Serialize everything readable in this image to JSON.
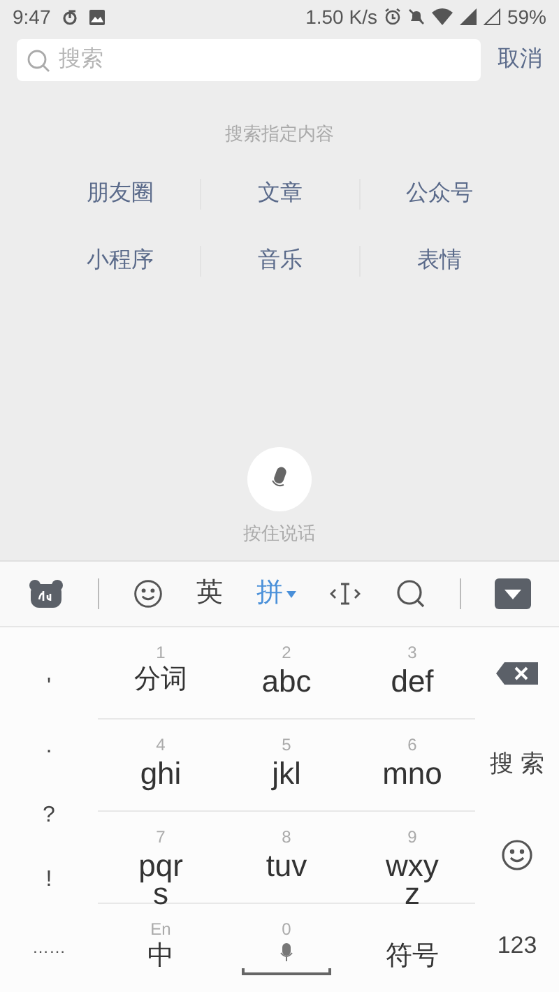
{
  "status_bar": {
    "time": "9:47",
    "speed": "1.50 K/s",
    "battery": "59%"
  },
  "search": {
    "placeholder": "搜索",
    "cancel": "取消"
  },
  "section_title": "搜索指定内容",
  "categories": [
    "朋友圈",
    "文章",
    "公众号",
    "小程序",
    "音乐",
    "表情"
  ],
  "voice": {
    "label": "按住说话"
  },
  "toolbar": [
    {
      "kind": "logo"
    },
    {
      "kind": "divider"
    },
    {
      "kind": "emoji"
    },
    {
      "kind": "mode",
      "label": "英",
      "selected": false
    },
    {
      "kind": "mode",
      "label": "拼",
      "selected": true
    },
    {
      "kind": "cursor"
    },
    {
      "kind": "search"
    },
    {
      "kind": "divider"
    },
    {
      "kind": "hide"
    }
  ],
  "punctuation": [
    "'",
    "·",
    "?",
    "!"
  ],
  "more_symbols": "……",
  "keys": [
    {
      "kind": "text",
      "number": "1",
      "label": "分词"
    },
    {
      "kind": "text",
      "number": "2",
      "label": "abc"
    },
    {
      "kind": "text",
      "number": "3",
      "label": "def"
    },
    {
      "kind": "text",
      "number": "4",
      "label": "ghi"
    },
    {
      "kind": "text",
      "number": "5",
      "label": "jkl"
    },
    {
      "kind": "text",
      "number": "6",
      "label": "mno"
    },
    {
      "kind": "text",
      "number": "7",
      "label": "pqr\ns"
    },
    {
      "kind": "text",
      "number": "8",
      "label": "tuv"
    },
    {
      "kind": "text",
      "number": "9",
      "label": "wxy\nz"
    },
    {
      "kind": "text",
      "number": "En",
      "label": "中"
    },
    {
      "kind": "space",
      "number": "0"
    },
    {
      "kind": "text",
      "label": "符号"
    }
  ],
  "side_keys": [
    {
      "kind": "backspace"
    },
    {
      "kind": "text",
      "label": "搜 索"
    },
    {
      "kind": "emoji"
    },
    {
      "kind": "text",
      "label": "123"
    }
  ]
}
